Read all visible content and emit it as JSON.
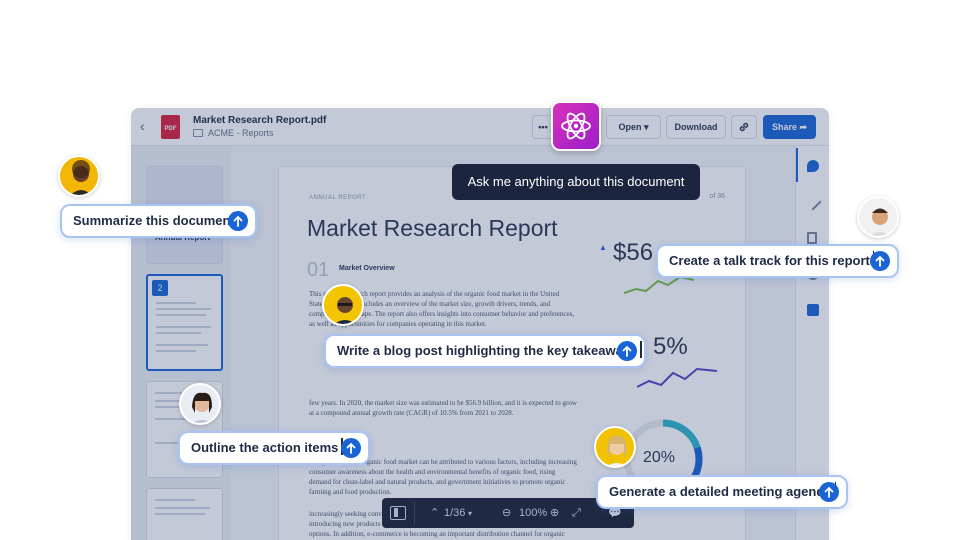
{
  "window": {
    "file_name": "Market Research Report.pdf",
    "folder_path": "ACME - Reports",
    "file_type": "PDF",
    "toolbar": {
      "more_label": "•••",
      "open_label": "Open ▾",
      "download_label": "Download",
      "share_label": "Share ➦"
    }
  },
  "thumbnails": {
    "first_title": "Annual Report",
    "active_page": "2"
  },
  "document": {
    "eyebrow": "ANNUAL REPORT",
    "page_of": "of 36",
    "title": "Market Research Report",
    "section_number": "01",
    "section_name": "Market Overview",
    "para1": "This market research report provides an analysis of the organic food market in the United States. The report includes an overview of the market size, growth drivers, trends, and competitive landscape. The report also offers insights into consumer behavior and preferences, as well as opportunities for companies operating in this market.",
    "para2": "few years. In 2020, the market size was estimated to be $56.9 billion, and it is expected to grow at a compound annual growth rate (CAGR) of 10.5% from 2021 to 2028.",
    "para3": "The growth of the organic food market can be attributed to various factors, including increasing consumer awareness about the health and environmental benefits of organic food, rising demand for clean-label and natural products, and government initiatives to promote organic farming and food production.",
    "para4": "increasingly seeking convenience and value for money, and companies are responding by introducing new products and packaging formats, such as ready-to-eat meals and single-serve options. In addition, e-commerce is becoming an important distribution channel for organic food products.",
    "stat1": "$56",
    "stat2": "5%",
    "donut_value": "20%"
  },
  "viewer_bar": {
    "page_indicator": "1/36",
    "zoom": "100%"
  },
  "assistant": {
    "tooltip": "Ask me anything about this document"
  },
  "prompts": [
    {
      "text": "Summarize this document"
    },
    {
      "text": "Create a talk track for this report"
    },
    {
      "text": "Write a blog post highlighting the key takeaways"
    },
    {
      "text": "Outline the action items"
    },
    {
      "text": "Generate a detailed meeting agenda"
    }
  ],
  "colors": {
    "accent": "#1a64d6",
    "ai_gradient_start": "#d92fbe",
    "ai_gradient_end": "#9b1fc9",
    "tooltip_bg": "#1c2540"
  }
}
